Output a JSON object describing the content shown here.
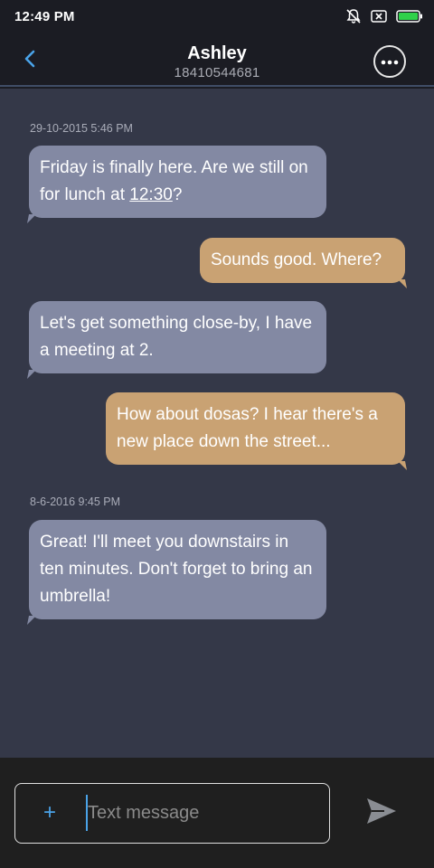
{
  "status_bar": {
    "time": "12:49 PM",
    "icons": [
      "notifications-off-icon",
      "sim-off-icon",
      "battery-icon"
    ],
    "battery_color": "#2fd14a"
  },
  "header": {
    "back_icon": "chevron-left-icon",
    "contact_name": "Ashley",
    "contact_number": "18410544681",
    "more_icon": "more-horizontal-icon",
    "accent_color": "#4aa3e8"
  },
  "conversation": {
    "timestamps": [
      "29-10-2015 5:46 PM",
      "8-6-2016 9:45 PM"
    ],
    "messages": [
      {
        "direction": "in",
        "text_before": "Friday is finally here. Are we still on for lunch at ",
        "link": "12:30",
        "text_after": "?"
      },
      {
        "direction": "out",
        "text": "Sounds good. Where?"
      },
      {
        "direction": "in",
        "text": "Let's get something close-by, I have a meeting at 2."
      },
      {
        "direction": "out",
        "text": "How about dosas? I hear there's a new place down the street..."
      },
      {
        "direction": "in",
        "text": "Great! I'll meet you downstairs in ten minutes. Don't forget to bring an umbrella!"
      }
    ],
    "incoming_color": "#8389a3",
    "outgoing_color": "#c9a273"
  },
  "composer": {
    "add_label": "+",
    "placeholder": "Text message",
    "send_icon": "send-icon"
  }
}
